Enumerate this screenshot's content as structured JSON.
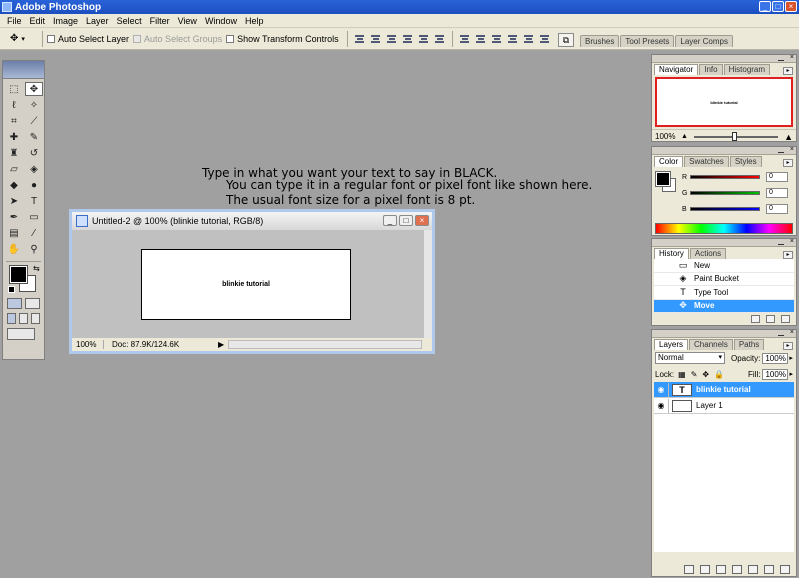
{
  "window": {
    "title": "Adobe Photoshop"
  },
  "menu": [
    "File",
    "Edit",
    "Image",
    "Layer",
    "Select",
    "Filter",
    "View",
    "Window",
    "Help"
  ],
  "options": {
    "auto_select_layer": "Auto Select Layer",
    "auto_select_groups": "Auto Select Groups",
    "show_transform_controls": "Show Transform Controls"
  },
  "palette_well": [
    "Brushes",
    "Tool Presets",
    "Layer Comps"
  ],
  "instructions": [
    "Type in what you want your text to say in BLACK.",
    "You can type it in a regular font or pixel font like shown here.",
    "The usual font size for a pixel font is 8 pt."
  ],
  "document": {
    "title": "Untitled-2 @ 100% (blinkie tutorial, RGB/8)",
    "canvas_text": "blinkie tutorial",
    "zoom": "100%",
    "doc_info": "Doc: 87.9K/124.6K"
  },
  "navigator": {
    "tabs": [
      "Navigator",
      "Info",
      "Histogram"
    ],
    "zoom": "100%",
    "preview_text": "blinkie tutorial"
  },
  "color_palette": {
    "tabs": [
      "Color",
      "Swatches",
      "Styles"
    ],
    "channels": [
      {
        "label": "R",
        "value": "0",
        "gradient": "#ff0000"
      },
      {
        "label": "G",
        "value": "0",
        "gradient": "#00c000"
      },
      {
        "label": "B",
        "value": "0",
        "gradient": "#0000ff"
      }
    ]
  },
  "history": {
    "tabs": [
      "History",
      "Actions"
    ],
    "items": [
      {
        "label": "New",
        "icon": "▭"
      },
      {
        "label": "Paint Bucket",
        "icon": "◈"
      },
      {
        "label": "Type Tool",
        "icon": "T"
      },
      {
        "label": "Move",
        "icon": "✥"
      }
    ]
  },
  "layers": {
    "tabs": [
      "Layers",
      "Channels",
      "Paths"
    ],
    "blend_mode": "Normal",
    "opacity_label": "Opacity:",
    "opacity": "100%",
    "lock_label": "Lock:",
    "fill_label": "Fill:",
    "fill": "100%",
    "items": [
      {
        "name": "blinkie tutorial",
        "thumb": "T"
      },
      {
        "name": "Layer 1",
        "thumb": ""
      }
    ]
  }
}
